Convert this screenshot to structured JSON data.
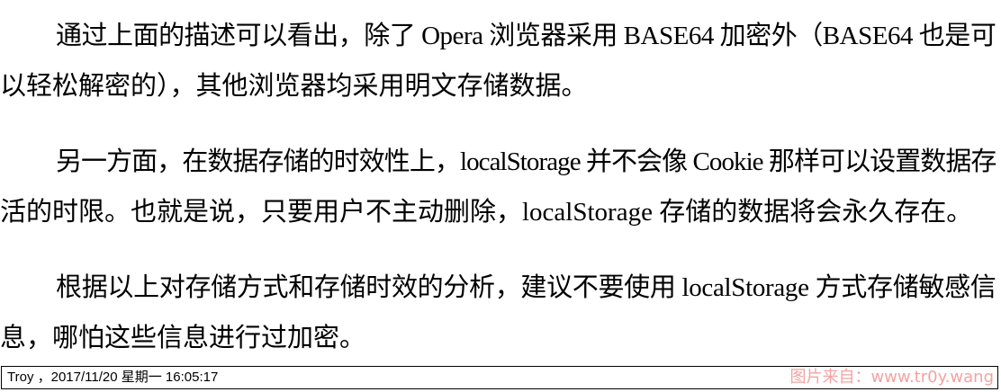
{
  "document": {
    "paragraphs": [
      {
        "lines": [
          "通过上面的描述可以看出，除了 Opera 浏览器采用 BASE64 加密外（BASE64 也是可",
          "以轻松解密的），其他浏览器均采用明文存储数据。"
        ]
      },
      {
        "lines": [
          "另一方面，在数据存储的时效性上，localStorage 并不会像 Cookie 那样可以设置数据存",
          "活的时限。也就是说，只要用户不主动删除，localStorage 存储的数据将会永久存在。"
        ]
      },
      {
        "lines": [
          "根据以上对存储方式和存储时效的分析，建议不要使用 localStorage 方式存储敏感信",
          "息，哪怕这些信息进行过加密。"
        ]
      }
    ]
  },
  "footer": {
    "text": "Troy ，2017/11/20 星期一 16:05:17",
    "watermark": "图片来自：www.tr0y.wang",
    "watermark_color": "#f2a3a3"
  }
}
